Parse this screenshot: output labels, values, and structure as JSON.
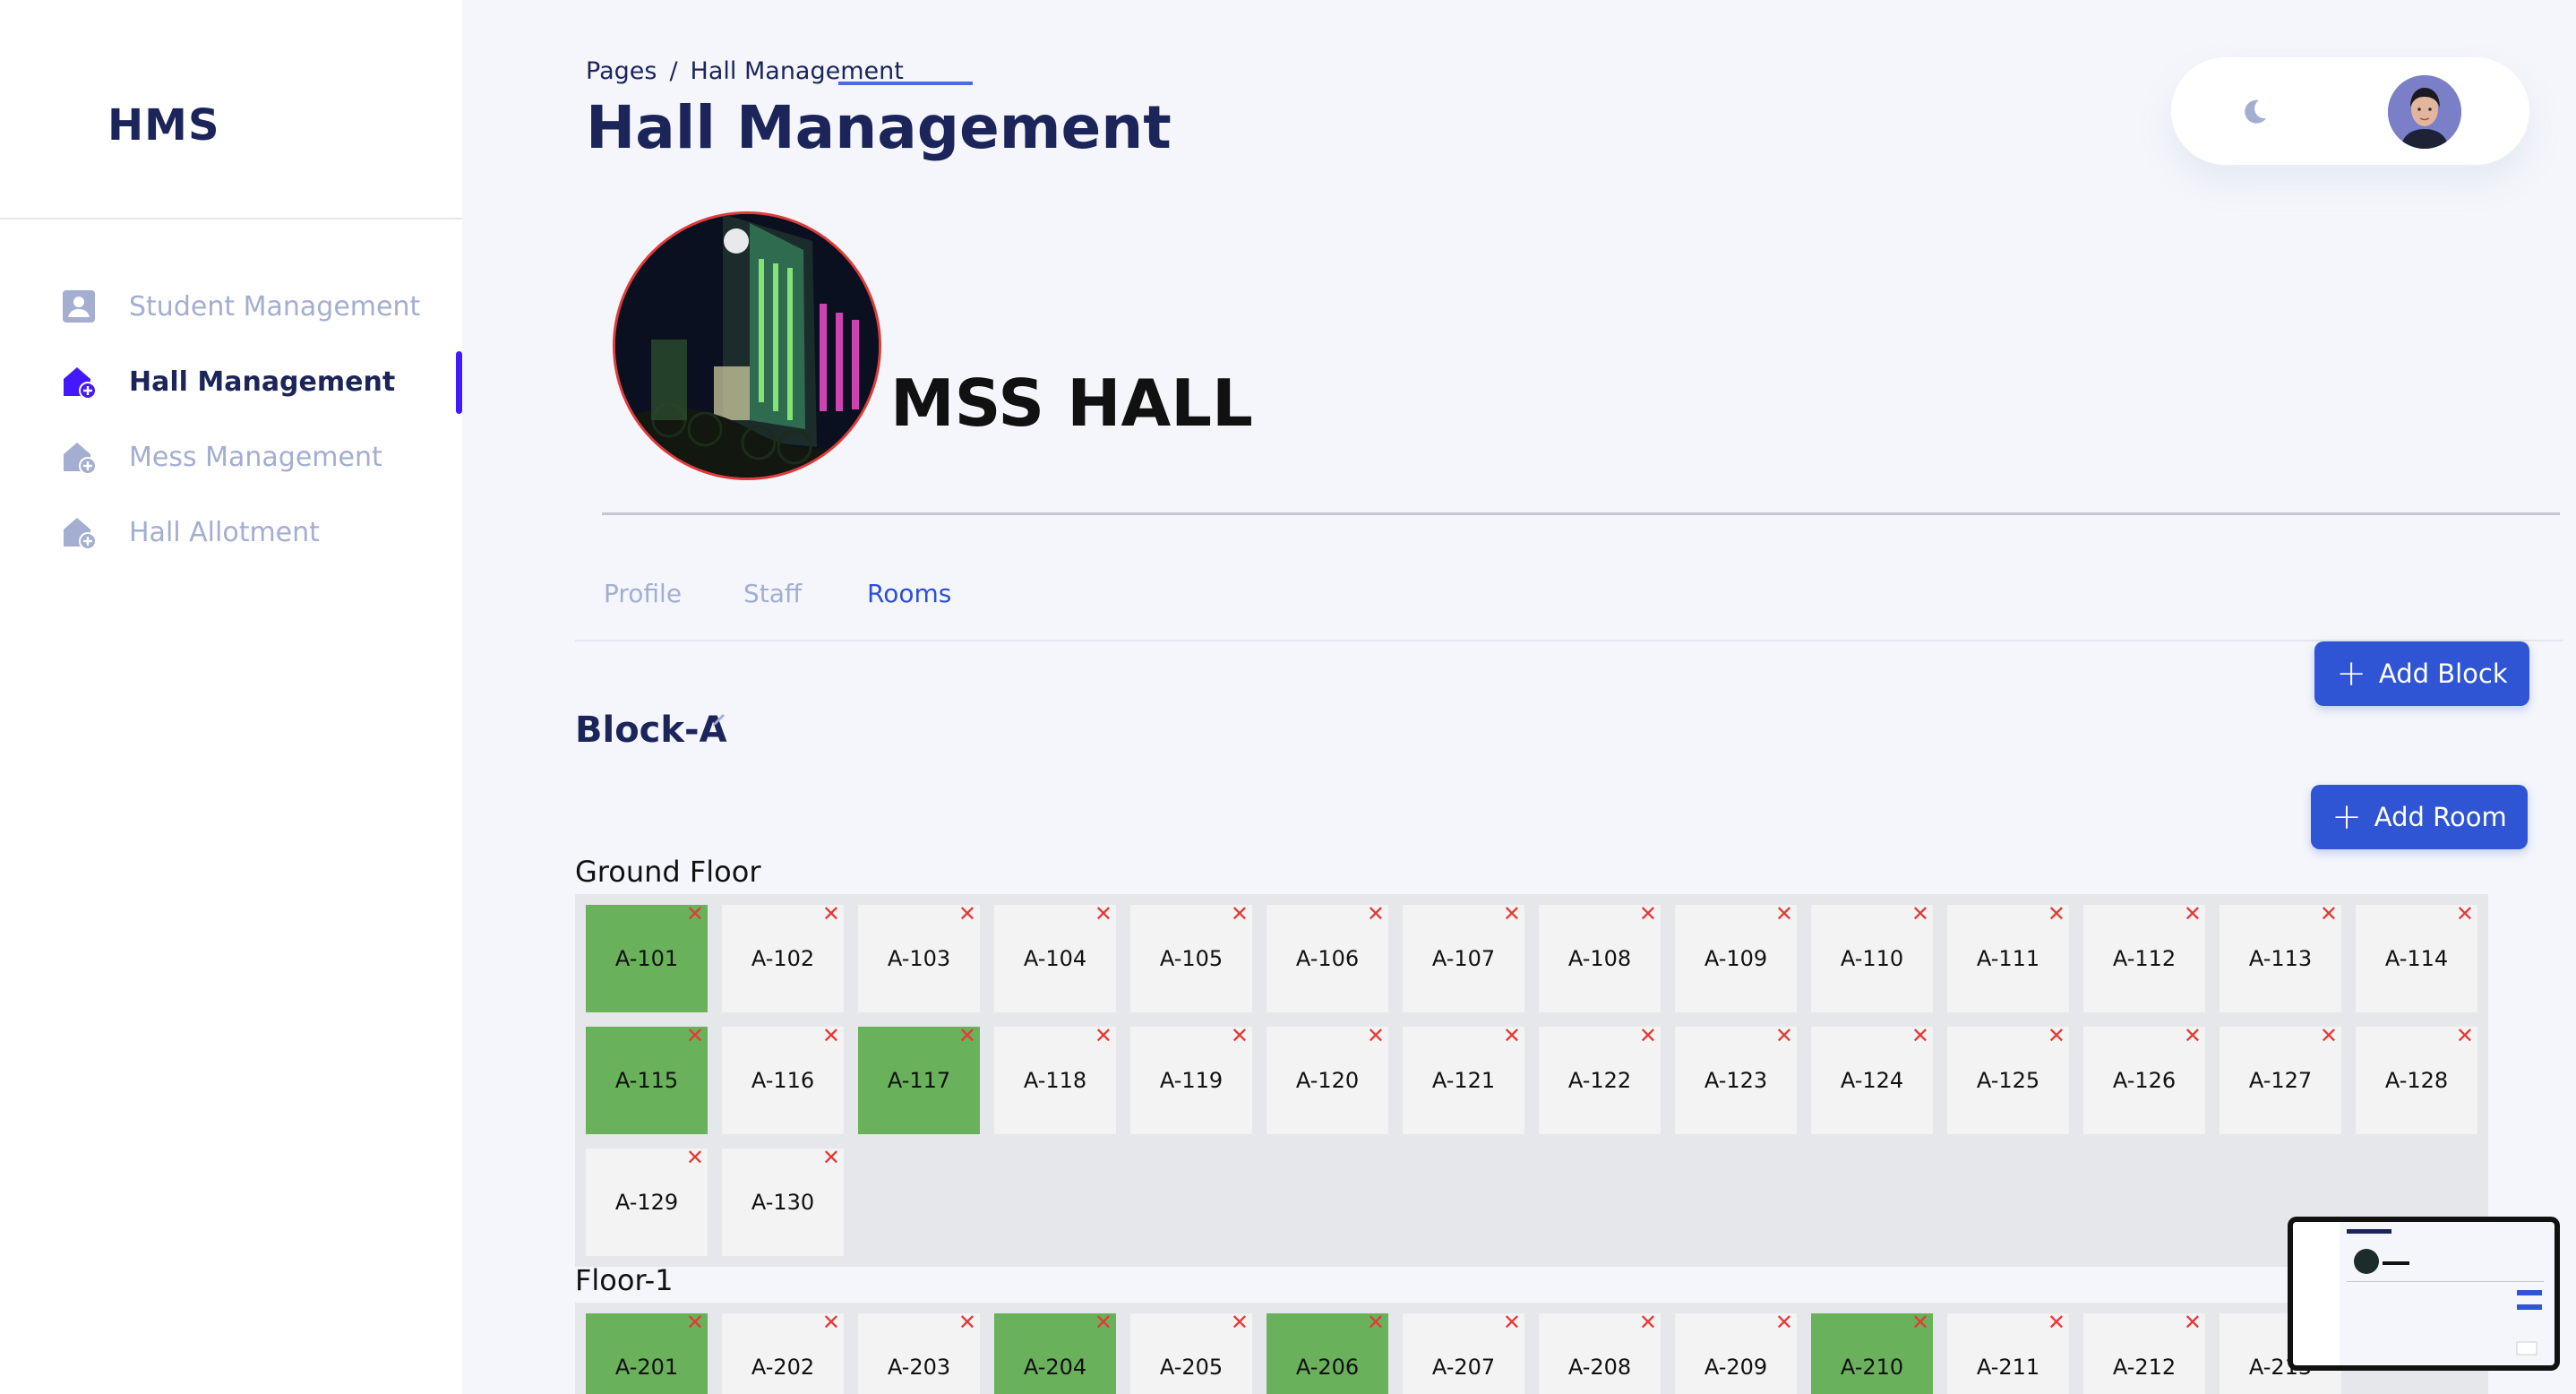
{
  "sidebar": {
    "brand": "HMS",
    "items": [
      {
        "label": "Student Management",
        "icon": "person-box-icon",
        "active": false
      },
      {
        "label": "Hall Management",
        "icon": "house-plus-icon",
        "active": true
      },
      {
        "label": "Mess Management",
        "icon": "house-plus-icon",
        "active": false
      },
      {
        "label": "Hall Allotment",
        "icon": "house-plus-icon",
        "active": false
      }
    ]
  },
  "header": {
    "breadcrumb_root": "Pages",
    "breadcrumb_sep": "/",
    "breadcrumb_current": "Hall Management",
    "title": "Hall Management"
  },
  "hall": {
    "name": "MSS HALL"
  },
  "tabs": [
    {
      "label": "Profile",
      "active": false
    },
    {
      "label": "Staff",
      "active": false
    },
    {
      "label": "Rooms",
      "active": true
    }
  ],
  "actions": {
    "add_block": "Add Block",
    "add_room": "Add Room"
  },
  "block": {
    "title": "Block-A"
  },
  "floors": [
    {
      "label": "Ground Floor",
      "rooms": [
        {
          "name": "A-101",
          "occupied": true
        },
        {
          "name": "A-102",
          "occupied": false
        },
        {
          "name": "A-103",
          "occupied": false
        },
        {
          "name": "A-104",
          "occupied": false
        },
        {
          "name": "A-105",
          "occupied": false
        },
        {
          "name": "A-106",
          "occupied": false
        },
        {
          "name": "A-107",
          "occupied": false
        },
        {
          "name": "A-108",
          "occupied": false
        },
        {
          "name": "A-109",
          "occupied": false
        },
        {
          "name": "A-110",
          "occupied": false
        },
        {
          "name": "A-111",
          "occupied": false
        },
        {
          "name": "A-112",
          "occupied": false
        },
        {
          "name": "A-113",
          "occupied": false
        },
        {
          "name": "A-114",
          "occupied": false
        },
        {
          "name": "A-115",
          "occupied": true
        },
        {
          "name": "A-116",
          "occupied": false
        },
        {
          "name": "A-117",
          "occupied": true
        },
        {
          "name": "A-118",
          "occupied": false
        },
        {
          "name": "A-119",
          "occupied": false
        },
        {
          "name": "A-120",
          "occupied": false
        },
        {
          "name": "A-121",
          "occupied": false
        },
        {
          "name": "A-122",
          "occupied": false
        },
        {
          "name": "A-123",
          "occupied": false
        },
        {
          "name": "A-124",
          "occupied": false
        },
        {
          "name": "A-125",
          "occupied": false
        },
        {
          "name": "A-126",
          "occupied": false
        },
        {
          "name": "A-127",
          "occupied": false
        },
        {
          "name": "A-128",
          "occupied": false
        },
        {
          "name": "A-129",
          "occupied": false
        },
        {
          "name": "A-130",
          "occupied": false
        }
      ]
    },
    {
      "label": "Floor-1",
      "rooms": [
        {
          "name": "A-201",
          "occupied": true
        },
        {
          "name": "A-202",
          "occupied": false
        },
        {
          "name": "A-203",
          "occupied": false
        },
        {
          "name": "A-204",
          "occupied": true
        },
        {
          "name": "A-205",
          "occupied": false
        },
        {
          "name": "A-206",
          "occupied": true
        },
        {
          "name": "A-207",
          "occupied": false
        },
        {
          "name": "A-208",
          "occupied": false
        },
        {
          "name": "A-209",
          "occupied": false
        },
        {
          "name": "A-210",
          "occupied": true
        },
        {
          "name": "A-211",
          "occupied": false
        },
        {
          "name": "A-212",
          "occupied": false
        },
        {
          "name": "A-213",
          "occupied": false
        }
      ]
    }
  ],
  "delete_glyph": "✕",
  "colors": {
    "accent": "#4318ff",
    "button": "#2f55d4",
    "occupied": "#6ab15b",
    "vacant": "#f3f3f4",
    "delete": "#e53935"
  }
}
